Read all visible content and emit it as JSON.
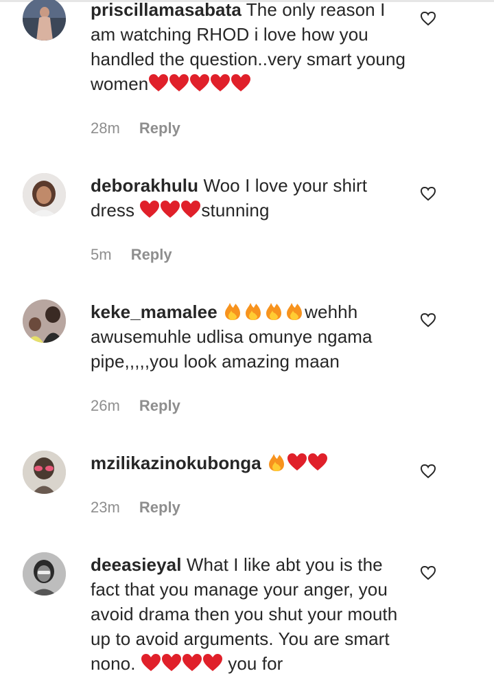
{
  "comments": [
    {
      "username": "priscillamasabata",
      "text": "The only reason I am watching RHOD i love how you handled the question..very smart young women",
      "emojis": [
        "red-heart",
        "red-heart",
        "red-heart",
        "red-heart",
        "red-heart"
      ],
      "time": "28m",
      "reply": "Reply"
    },
    {
      "username": "deborakhulu",
      "text_before": "Woo I love your shirt dress ",
      "emojis": [
        "red-heart",
        "red-heart",
        "red-heart"
      ],
      "text_after": "stunning",
      "time": "5m",
      "reply": "Reply"
    },
    {
      "username": "keke_mamalee",
      "emojis": [
        "fire",
        "fire",
        "fire",
        "fire"
      ],
      "text": "wehhh awusemuhle udlisa omunye ngama pipe,,,,,you look amazing maan",
      "time": "26m",
      "reply": "Reply"
    },
    {
      "username": "mzilikazinokubonga",
      "emojis": [
        "fire",
        "red-heart",
        "red-heart"
      ],
      "time": "23m",
      "reply": "Reply"
    },
    {
      "username": "deeasieyal",
      "text_before": "What I like abt you is the fact that you manage your anger, you avoid drama then you shut your mouth up to avoid arguments. You are smart nono. ",
      "emojis": [
        "red-heart",
        "red-heart",
        "red-heart",
        "red-heart"
      ],
      "text_after": " you for"
    }
  ],
  "colors": {
    "text": "#262626",
    "muted": "#8e8e8e",
    "heart_red": "#e0202a",
    "fire_orange": "#f7931e"
  },
  "icons": {
    "like": "heart-outline-icon"
  }
}
